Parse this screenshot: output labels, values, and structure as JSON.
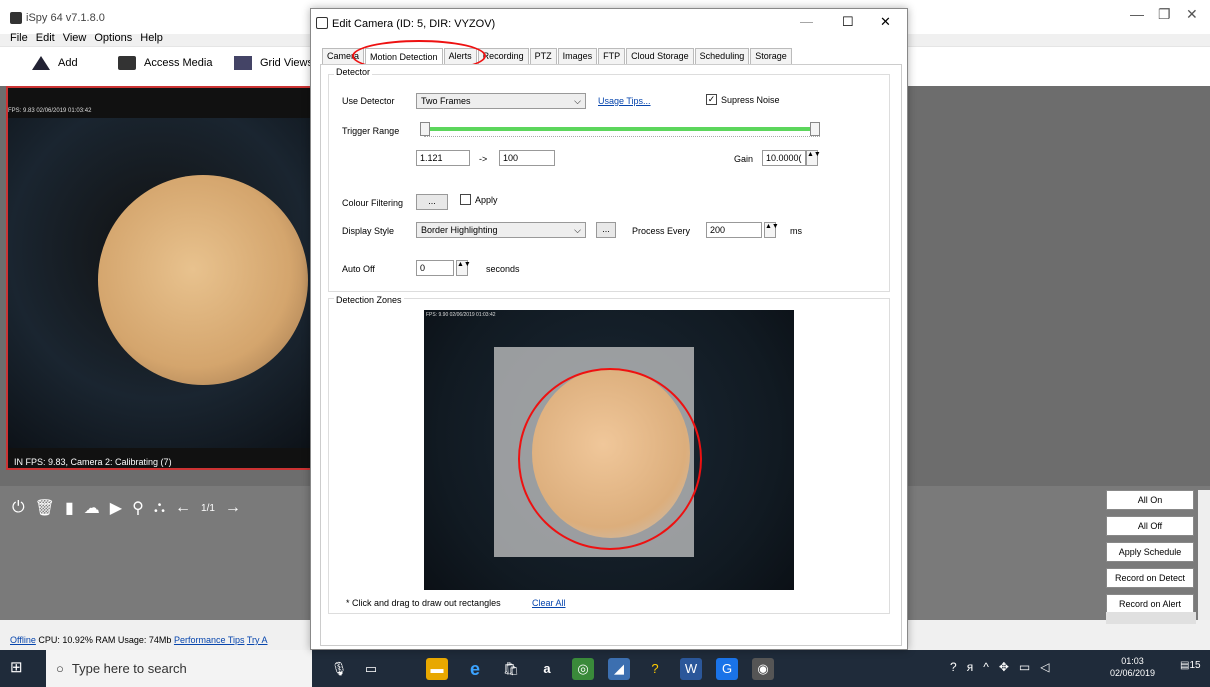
{
  "app": {
    "title": "iSpy 64 v7.1.8.0",
    "menu": [
      "File",
      "Edit",
      "View",
      "Options",
      "Help"
    ]
  },
  "toolbar": {
    "add": "Add",
    "access_media": "Access Media",
    "grid_views": "Grid Views"
  },
  "camera_panel": {
    "fps_overlay": "FPS: 9.83 02/06/2019 01:03:42",
    "status": "IN  FPS: 9.83, Camera 2: Calibrating (7)",
    "page": "1/1"
  },
  "side_buttons": [
    "All On",
    "All Off",
    "Apply Schedule",
    "Record on Detect",
    "Record on Alert"
  ],
  "statusbar": {
    "offline": "Offline",
    "usage": "CPU: 10.92% RAM Usage: 74Mb",
    "perf": "Performance Tips",
    "try": "Try A"
  },
  "dialog": {
    "title": "Edit Camera (ID: 5, DIR: VYZOV)",
    "tabs": [
      "Camera",
      "Motion Detection",
      "Alerts",
      "Recording",
      "PTZ",
      "Images",
      "FTP",
      "Cloud Storage",
      "Scheduling",
      "Storage"
    ],
    "detector": {
      "group_label": "Detector",
      "use_detector_label": "Use Detector",
      "use_detector_value": "Two Frames",
      "usage_tips": "Usage Tips...",
      "supress_noise": "Supress Noise",
      "trigger_range_label": "Trigger Range",
      "range_min": "1.121",
      "arrow": "->",
      "range_max": "100",
      "gain_label": "Gain",
      "gain_value": "10.0000(",
      "colour_filtering_label": "Colour Filtering",
      "ellipsis": "...",
      "apply": "Apply",
      "display_style_label": "Display Style",
      "display_style_value": "Border Highlighting",
      "process_every_label": "Process Every",
      "process_every_value": "200",
      "ms": "ms",
      "auto_off_label": "Auto Off",
      "auto_off_value": "0",
      "seconds": "seconds"
    },
    "zones": {
      "group_label": "Detection Zones",
      "fps_overlay": "FPS: 9.90 02/06/2019 01:03:42",
      "hint": "* Click and drag to draw out rectangles",
      "clear_all": "Clear All"
    }
  },
  "taskbar": {
    "search_placeholder": "Type here to search",
    "time": "01:03",
    "date": "02/06/2019",
    "notif_count": "15"
  }
}
